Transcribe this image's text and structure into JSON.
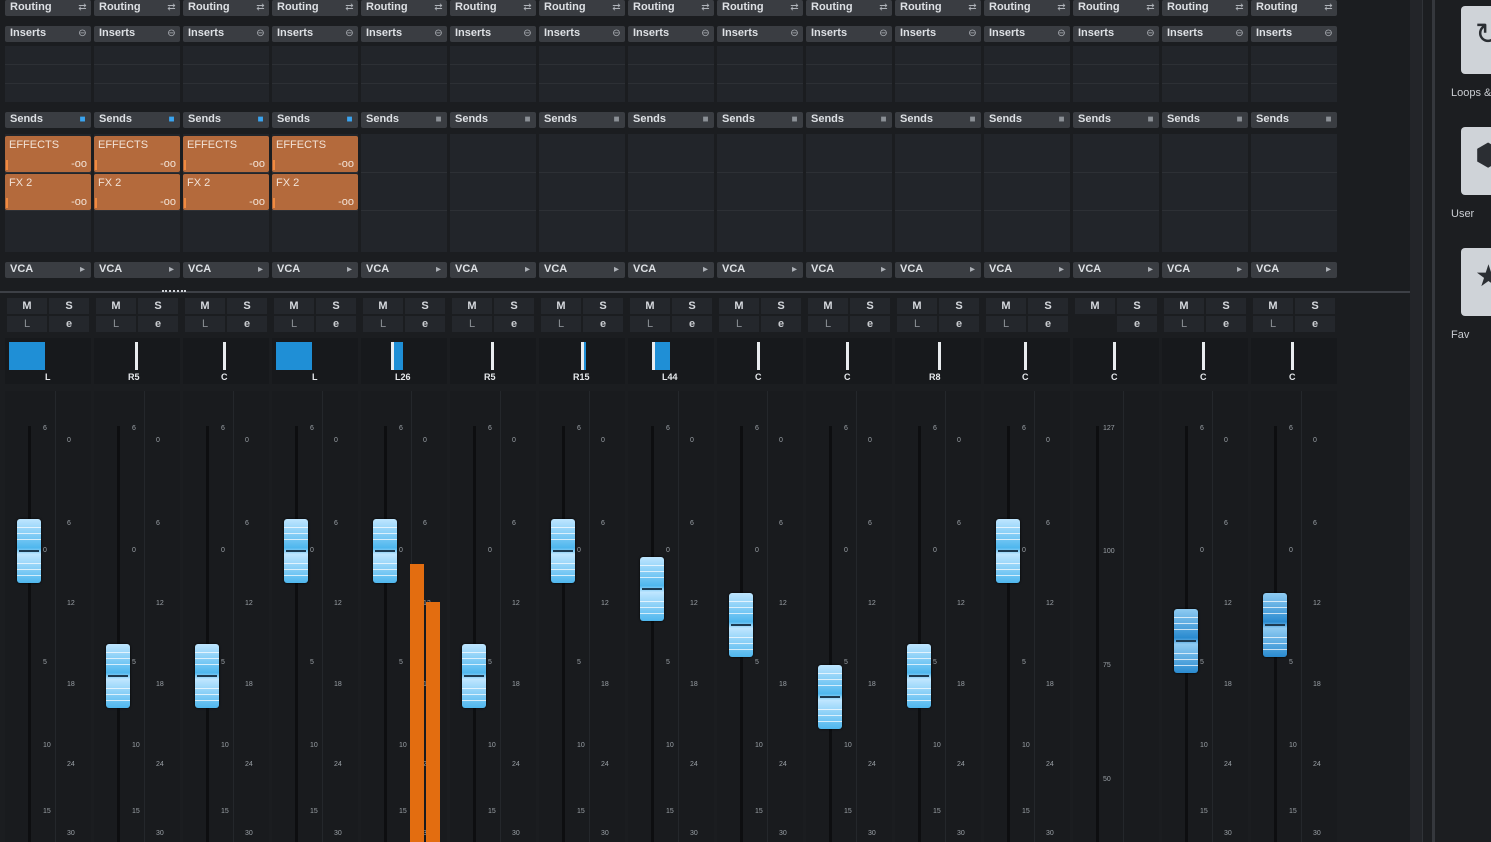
{
  "labels": {
    "routing": "Routing",
    "inserts": "Inserts",
    "sends": "Sends",
    "vca": "VCA",
    "mute": "M",
    "solo": "S",
    "listen": "L"
  },
  "channels": [
    {
      "pan": "L",
      "sends": [
        {
          "name": "EFFECTS",
          "value": "-oo"
        },
        {
          "name": "FX 2",
          "value": "-oo"
        }
      ],
      "sends_active": true,
      "fader_db": "0"
    },
    {
      "pan": "R5",
      "sends": [
        {
          "name": "EFFECTS",
          "value": "-oo"
        },
        {
          "name": "FX 2",
          "value": "-oo"
        }
      ],
      "sends_active": true,
      "fader_db": "-5"
    },
    {
      "pan": "C",
      "sends": [
        {
          "name": "EFFECTS",
          "value": "-oo"
        },
        {
          "name": "FX 2",
          "value": "-oo"
        }
      ],
      "sends_active": true,
      "fader_db": "-5"
    },
    {
      "pan": "L",
      "sends": [
        {
          "name": "EFFECTS",
          "value": "-oo"
        },
        {
          "name": "FX 2",
          "value": "-oo"
        }
      ],
      "sends_active": true,
      "fader_db": "0"
    },
    {
      "pan": "L26",
      "sends": [],
      "sends_active": false,
      "fader_db": "0"
    },
    {
      "pan": "R5",
      "sends": [],
      "sends_active": false,
      "fader_db": "-5"
    },
    {
      "pan": "R15",
      "sends": [],
      "sends_active": false,
      "fader_db": "0"
    },
    {
      "pan": "L44",
      "sends": [],
      "sends_active": false,
      "fader_db": "-2"
    },
    {
      "pan": "C",
      "sends": [],
      "sends_active": false,
      "fader_db": "-3"
    },
    {
      "pan": "C",
      "sends": [],
      "sends_active": false,
      "fader_db": "-6"
    },
    {
      "pan": "R8",
      "sends": [],
      "sends_active": false,
      "fader_db": "-5"
    },
    {
      "pan": "C",
      "sends": [],
      "sends_active": false,
      "fader_db": "0"
    },
    {
      "pan": "C",
      "sends": [],
      "sends_active": false,
      "fader_db": "",
      "midi": true
    },
    {
      "pan": "C",
      "sends": [],
      "sends_active": false,
      "fader_db": "-4"
    },
    {
      "pan": "C",
      "sends": [],
      "sends_active": false,
      "fader_db": "-3"
    }
  ],
  "scale_left": [
    "6",
    "0",
    "6",
    "12",
    "18",
    "10",
    "15"
  ],
  "scale_right": [
    "0",
    "6",
    "12",
    "18",
    "24",
    "30"
  ],
  "scale_left_mid": [
    "0",
    "5",
    "10",
    "15"
  ],
  "midi_scale": [
    "127",
    "100",
    "75",
    "50"
  ],
  "right_panel": [
    {
      "label": "Loops &",
      "icon": "loop-icon"
    },
    {
      "label": "User",
      "icon": "user-presets-icon"
    },
    {
      "label": "Fav",
      "icon": "star-icon"
    }
  ],
  "colors": {
    "send_slot": "#b46a3c",
    "meter": "#e36d10",
    "fader_cap": "#4fb7ee",
    "pan": "#1f8fd6"
  }
}
